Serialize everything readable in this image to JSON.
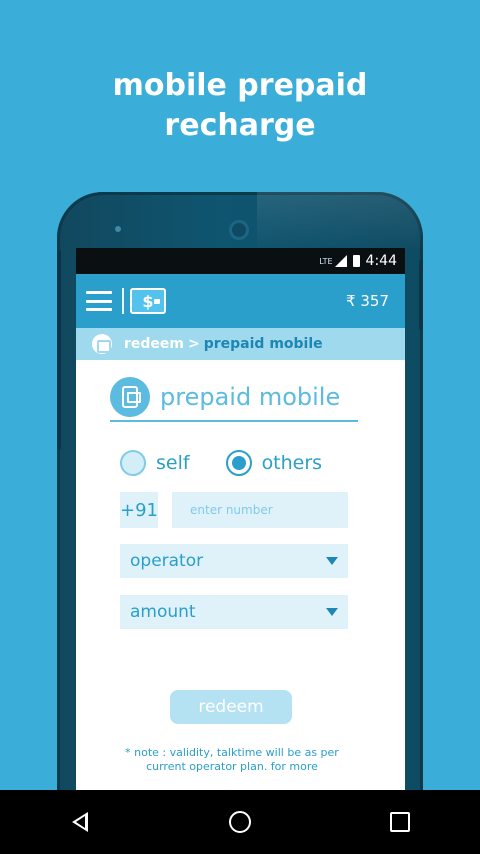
{
  "headline": {
    "line1": "mobile prepaid",
    "line2": "recharge"
  },
  "status_bar": {
    "network": "LTE",
    "time": "4:44"
  },
  "app_bar": {
    "wallet_symbol": "$",
    "balance": "₹ 357"
  },
  "breadcrumb": {
    "parent": "redeem",
    "separator": ">",
    "current": "prepaid mobile"
  },
  "form": {
    "title": "prepaid mobile",
    "radio_options": [
      {
        "label": "self",
        "checked": false
      },
      {
        "label": "others",
        "checked": true
      }
    ],
    "country_code": "+91",
    "number_placeholder": "enter number",
    "operator_label": "operator",
    "amount_label": "amount",
    "redeem_label": "redeem",
    "note": "* note : validity, talktime will be as per current operator plan. for more"
  },
  "colors": {
    "background": "#3aaed8",
    "app_bar": "#2a9fcb",
    "breadcrumb": "#9fd9ee",
    "accent": "#5bbbe0"
  },
  "icons": {
    "menu": "hamburger-menu-icon",
    "wallet": "wallet-icon",
    "bag": "shopping-bag-icon",
    "sim": "mobile-phone-icon",
    "back": "back-icon",
    "home": "home-icon",
    "recents": "recents-icon"
  }
}
